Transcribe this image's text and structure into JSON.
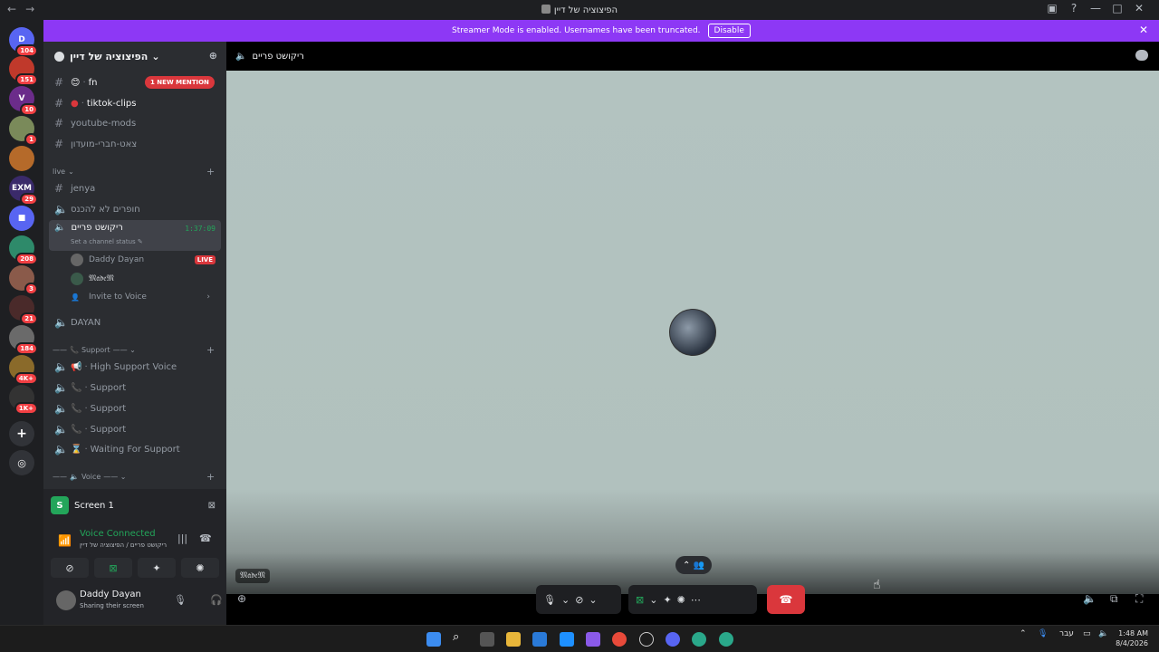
{
  "window": {
    "title": "הפיצוציה של דיין",
    "back": "←",
    "forward": "→"
  },
  "promo": {
    "text": "Streamer Mode is enabled. Usernames have been truncated.",
    "disable": "Disable",
    "close": "✕"
  },
  "servers": [
    {
      "badge": "104",
      "color": "#5865f2",
      "label": "D"
    },
    {
      "badge": "151",
      "color": "#c0392b",
      "label": ""
    },
    {
      "badge": "10",
      "color": "#6b2c8a",
      "label": "V"
    },
    {
      "badge": "1",
      "color": "#7a8a5a",
      "label": ""
    },
    {
      "badge": "",
      "color": "#b56a2a",
      "label": ""
    },
    {
      "badge": "29",
      "color": "#3a2a6a",
      "label": "EXM"
    },
    {
      "badge": "",
      "color": "#5865f2",
      "label": "■"
    },
    {
      "badge": "208",
      "color": "#2e8a6a",
      "label": ""
    },
    {
      "badge": "3",
      "color": "#8a5a4a",
      "label": ""
    },
    {
      "badge": "21",
      "color": "#4a2a2a",
      "label": ""
    },
    {
      "badge": "184",
      "color": "#6a6a6a",
      "label": ""
    },
    {
      "badge": "4K+",
      "color": "#8a6a2a",
      "label": ""
    },
    {
      "badge": "1K+",
      "color": "#333",
      "label": ""
    }
  ],
  "sidebar": {
    "server_name": "הפיצוציה של דיין",
    "channels": {
      "fn": "fn",
      "mention": "1 NEW MENTION",
      "tiktok": "tiktok-clips",
      "youtube": "youtube-mods",
      "chat": "צאט-חברי-מועדון",
      "live_cat": "live",
      "jenya": "jenya",
      "no_enter": "חופרים לא להכנס",
      "active": "ריקושט פריים",
      "active_time": "1:37:09",
      "active_status": "Set a channel status",
      "user1": "Daddy Dayan",
      "live_badge": "LIVE",
      "user2": "𝔐𝔞𝔡𝔢𝔐",
      "invite": "Invite to Voice",
      "dayan": "DAYAN",
      "support_cat": "Support",
      "high_support": "High Support Voice",
      "support1": "Support",
      "support2": "Support",
      "support3": "Support",
      "waiting": "Waiting For Support",
      "voice_cat": "Voice"
    }
  },
  "panel": {
    "screen": "Screen 1",
    "voice_connected": "Voice Connected",
    "voice_sub": "ריקושט פריים / הפיצוציה של דיין",
    "user_name": "Daddy Dayan",
    "user_status": "Sharing their screen"
  },
  "main": {
    "channel": "ריקושט פריים",
    "name_tag": "𝔐𝔞𝔡𝔢𝔐"
  },
  "taskbar": {
    "lang": "עבר",
    "time": "1:48 AM",
    "date": "8/4/2026"
  }
}
